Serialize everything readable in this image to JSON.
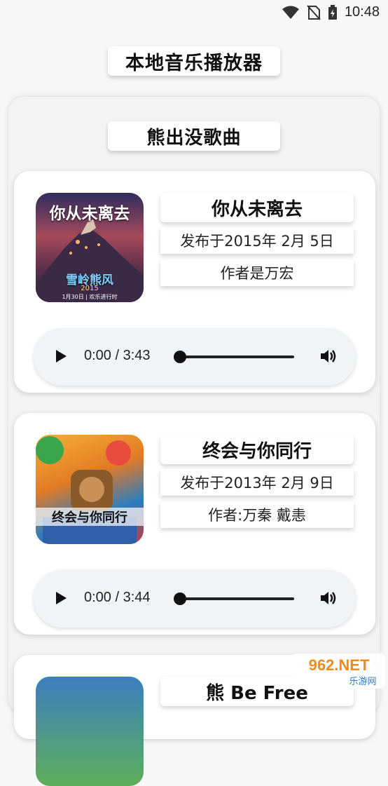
{
  "status_bar": {
    "time": "10:48"
  },
  "header": {
    "title": "本地音乐播放器"
  },
  "album": {
    "title": "熊出没歌曲"
  },
  "songs": [
    {
      "cover_text": "你从未离去",
      "cover_sub": "雪岭熊风",
      "cover_year": "2015",
      "cover_date": "1月30日 | 欢乐进行时",
      "name": "你从未离去",
      "release": "发布于2015年 2月 5日",
      "author": "作者是万宏",
      "player": {
        "time": "0:00 / 3:43"
      }
    },
    {
      "cover_text": "终会与你同行",
      "name": "终会与你同行",
      "release": "发布于2013年 2月 9日",
      "author": "作者:万秦 戴恚",
      "player": {
        "time": "0:00 / 3:44"
      }
    },
    {
      "name": "熊 Be Free"
    }
  ],
  "watermark": {
    "brand": "962.NET",
    "sub": "乐游网"
  }
}
